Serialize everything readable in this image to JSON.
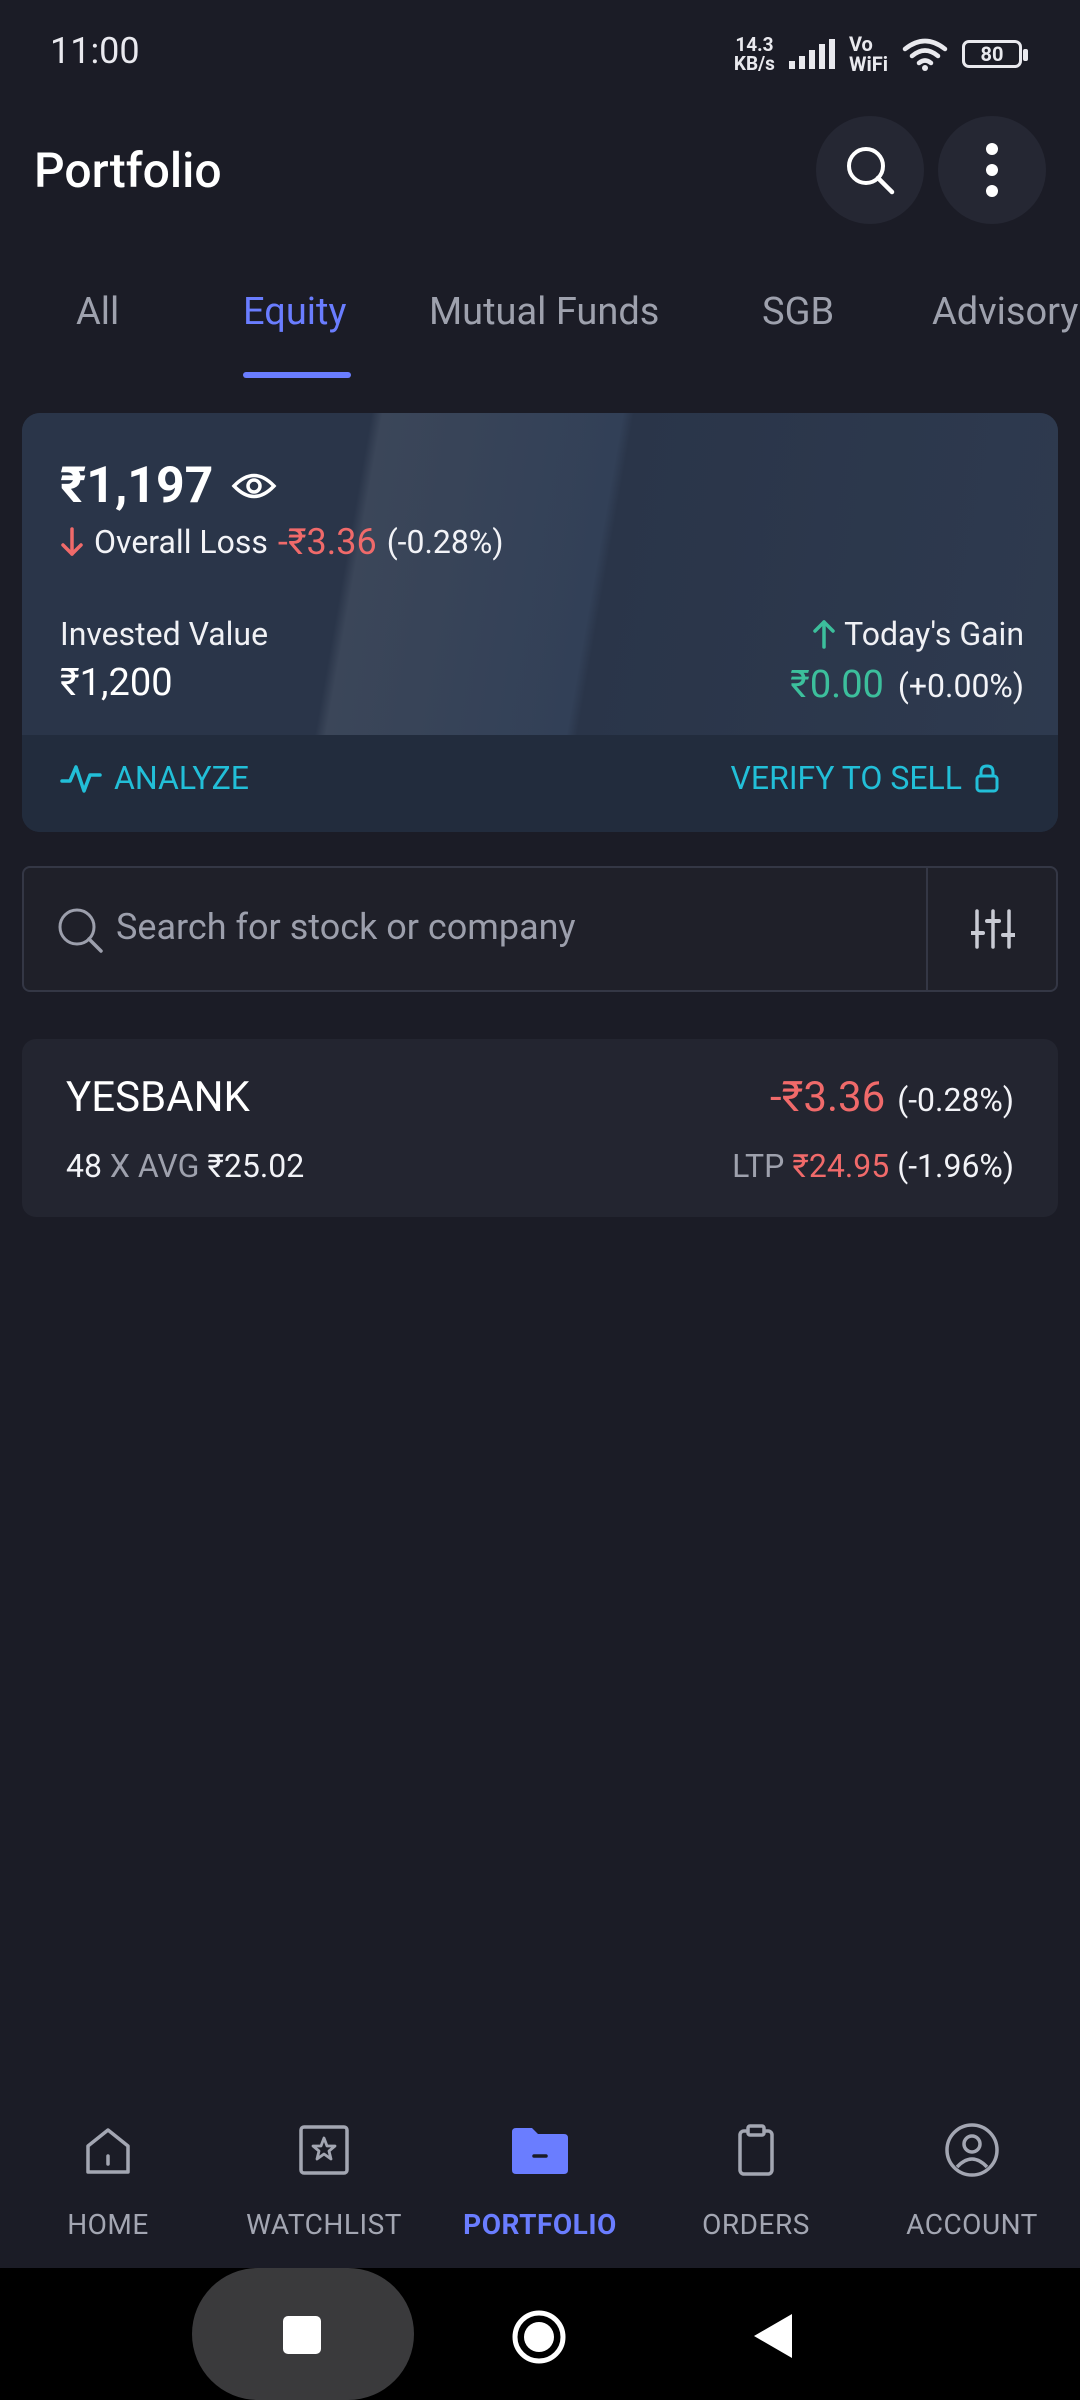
{
  "status_bar": {
    "time": "11:00",
    "net_speed_value": "14.3",
    "net_speed_unit": "KB/s",
    "vo": "Vo",
    "wifi": "WiFi",
    "battery": "80"
  },
  "header": {
    "title": "Portfolio",
    "icons": [
      "search-icon",
      "more-vertical-icon"
    ]
  },
  "tabs": [
    {
      "label": "All",
      "active": false
    },
    {
      "label": "Equity",
      "active": true
    },
    {
      "label": "Mutual Funds",
      "active": false
    },
    {
      "label": "SGB",
      "active": false
    },
    {
      "label": "Advisory",
      "active": false
    }
  ],
  "summary": {
    "current_value": "₹1,197",
    "overall_label": "Overall Loss",
    "overall_amount": "-₹3.36",
    "overall_pct": "(-0.28%)",
    "invested_label": "Invested Value",
    "invested_value": "₹1,200",
    "today_label": "Today's Gain",
    "today_amount": "₹0.00",
    "today_pct": "(+0.00%)",
    "analyze_label": "ANALYZE",
    "verify_label": "VERIFY TO SELL"
  },
  "search": {
    "placeholder": "Search for stock or company"
  },
  "holdings": [
    {
      "symbol": "YESBANK",
      "qty": "48",
      "x": "X",
      "avg_label": "AVG",
      "avg": "₹25.02",
      "pl": "-₹3.36",
      "pl_pct": "(-0.28%)",
      "ltp_label": "LTP",
      "ltp": "₹24.95",
      "ltp_pct": "(-1.96%)"
    }
  ],
  "bottom_nav": [
    {
      "label": "HOME",
      "icon": "home-icon",
      "active": false
    },
    {
      "label": "WATCHLIST",
      "icon": "watchlist-star-icon",
      "active": false
    },
    {
      "label": "PORTFOLIO",
      "icon": "portfolio-folder-icon",
      "active": true
    },
    {
      "label": "ORDERS",
      "icon": "orders-clipboard-icon",
      "active": false
    },
    {
      "label": "ACCOUNT",
      "icon": "account-icon",
      "active": false
    }
  ],
  "colors": {
    "accent": "#6a7dff",
    "loss": "#f06a6a",
    "gain": "#3cbf9c",
    "link": "#22bfd8",
    "background": "#1b1c26"
  }
}
